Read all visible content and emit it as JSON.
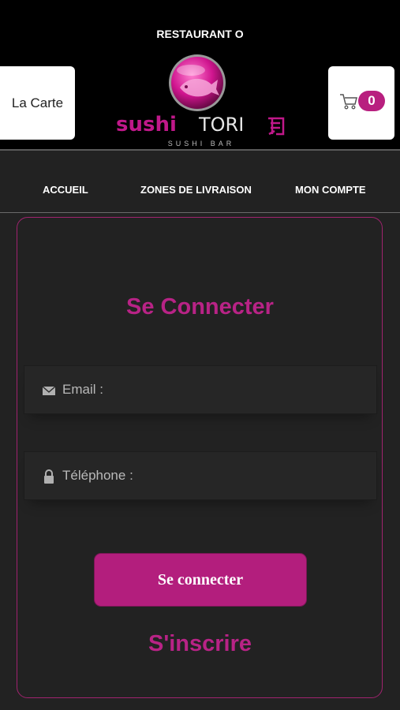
{
  "header": {
    "status_text": "RESTAURANT O",
    "menu_button_label": "La Carte",
    "cart_count": "0",
    "logo": {
      "brand_left": "sushi",
      "brand_right": "TORI",
      "subtitle": "SUSHI BAR"
    }
  },
  "nav": {
    "items": [
      {
        "label": "ACCUEIL"
      },
      {
        "label": "ZONES DE LIVRAISON"
      },
      {
        "label": "MON COMPTE"
      }
    ]
  },
  "login": {
    "title": "Se Connecter",
    "email_label": "Email :",
    "phone_label": "Téléphone :",
    "submit_label": "Se connecter",
    "register_label": "S'inscrire"
  },
  "colors": {
    "accent": "#b81f7f",
    "background": "#222222",
    "header_bg": "#000000"
  },
  "icons": [
    "cart-icon",
    "envelope-icon",
    "lock-icon",
    "fish-logo-icon"
  ]
}
